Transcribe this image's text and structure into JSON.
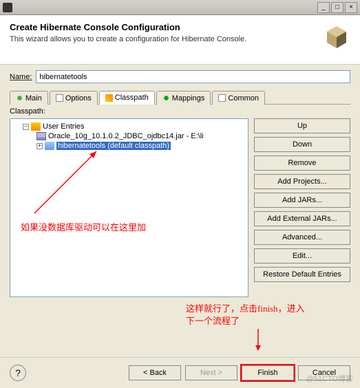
{
  "titlebar": {
    "minimize": "_",
    "maximize": "□",
    "close": "×"
  },
  "header": {
    "title": "Create Hibernate Console Configuration",
    "subtitle": "This wizard allows you to create a configuration for Hibernate Console."
  },
  "name": {
    "label": "Name:",
    "value": "hibernatetools"
  },
  "tabs": {
    "main": "Main",
    "options": "Options",
    "classpath": "Classpath",
    "mappings": "Mappings",
    "common": "Common"
  },
  "classpath_label": "Classpath:",
  "tree": {
    "user_entries": "User Entries",
    "jar": "Oracle_10g_10.1.0.2_JDBC_ojdbc14.jar - E:\\li",
    "jar_010": "010",
    "default": "hibernatetools (default classpath)"
  },
  "buttons": {
    "up": "Up",
    "down": "Down",
    "remove": "Remove",
    "add_projects": "Add Projects...",
    "add_jars": "Add JARs...",
    "add_external_jars": "Add External JARs...",
    "advanced": "Advanced...",
    "edit": "Edit...",
    "restore": "Restore Default Entries"
  },
  "footer": {
    "help": "?",
    "back": "< Back",
    "next": "Next >",
    "finish": "Finish",
    "cancel": "Cancel"
  },
  "annotations": {
    "left": "如果没数据库驱动可以在这里加",
    "right": "这样就行了，点击finish，进入下一个流程了"
  },
  "watermark": "@51CTO博客"
}
